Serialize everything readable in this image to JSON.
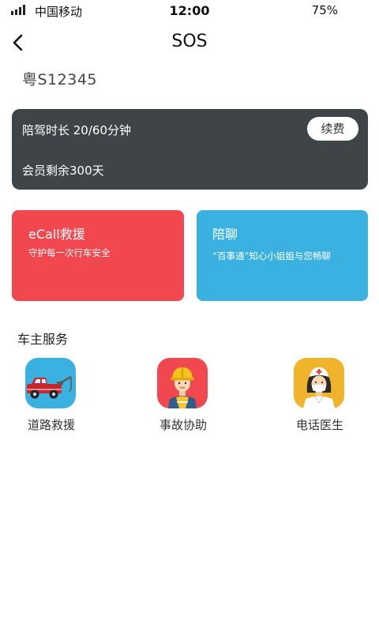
{
  "status_bar": {
    "carrier": "中国移动",
    "time": "12:00",
    "battery": "75%"
  },
  "nav": {
    "title": "SOS",
    "back_icon": "chevron-left-icon"
  },
  "plate_number": "粤S12345",
  "membership": {
    "duration_text": "陪驾时长 20/60分钟",
    "renew_label": "续费",
    "remaining_text": "会员剩余300天",
    "background_color": "#3e4447"
  },
  "cards": [
    {
      "title": "eCall救援",
      "subtitle": "守护每一次行车安全",
      "color": "#f1484f"
    },
    {
      "title": "陪聊",
      "subtitle": "“百事通”知心小姐姐与您畅聊",
      "color": "#3ab1e0"
    }
  ],
  "services": {
    "title": "车主服务",
    "items": [
      {
        "label": "道路救援",
        "icon": "tow-truck-icon",
        "color": "#3ab1e0"
      },
      {
        "label": "事故协助",
        "icon": "worker-icon",
        "color": "#f1484f"
      },
      {
        "label": "电话医生",
        "icon": "nurse-icon",
        "color": "#f0b42c"
      }
    ]
  }
}
